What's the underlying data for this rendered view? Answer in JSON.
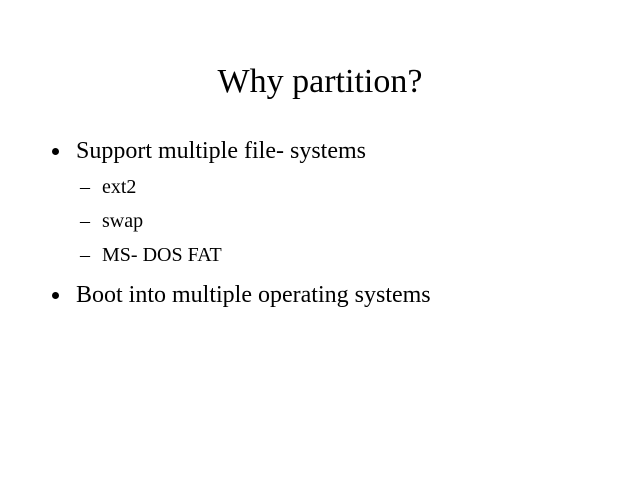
{
  "slide": {
    "title": "Why partition?",
    "bullets": [
      {
        "text": "Support multiple file- systems",
        "sub_marker": "–",
        "subitems": [
          "ext2",
          "swap",
          "MS- DOS FAT"
        ]
      },
      {
        "text": "Boot into multiple operating systems"
      }
    ]
  }
}
